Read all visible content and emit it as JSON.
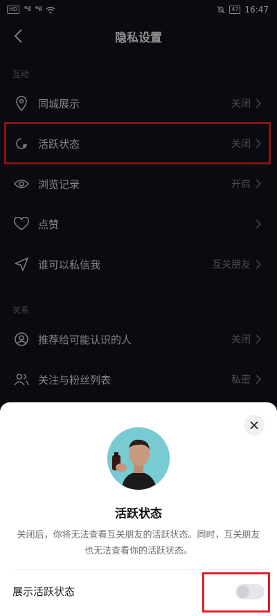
{
  "status_bar": {
    "left_badge": "HD",
    "signal_1": "⁴⁶ıll",
    "signal_2": "⁴⁶ıll",
    "battery": "47",
    "time": "16:47"
  },
  "header": {
    "title": "隐私设置"
  },
  "sections": [
    {
      "label": "互动",
      "items": [
        {
          "label": "同城展示",
          "value": "关闭"
        },
        {
          "label": "活跃状态",
          "value": "关闭"
        },
        {
          "label": "浏览记录",
          "value": "开启"
        },
        {
          "label": "点赞",
          "value": ""
        },
        {
          "label": "谁可以私信我",
          "value": "互关朋友"
        }
      ]
    },
    {
      "label": "关系",
      "items": [
        {
          "label": "推荐给可能认识的人",
          "value": "关闭"
        },
        {
          "label": "关注与粉丝列表",
          "value": "私密"
        }
      ]
    }
  ],
  "sheet": {
    "title": "活跃状态",
    "description": "关闭后，你将无法查看互关朋友的活跃状态。同时，互关朋友也无法查看你的活跃状态。",
    "toggle_label": "展示活跃状态",
    "toggle_on": false
  },
  "colors": {
    "background": "#111217",
    "highlight": "#e11d25",
    "sheet": "#ffffff"
  }
}
